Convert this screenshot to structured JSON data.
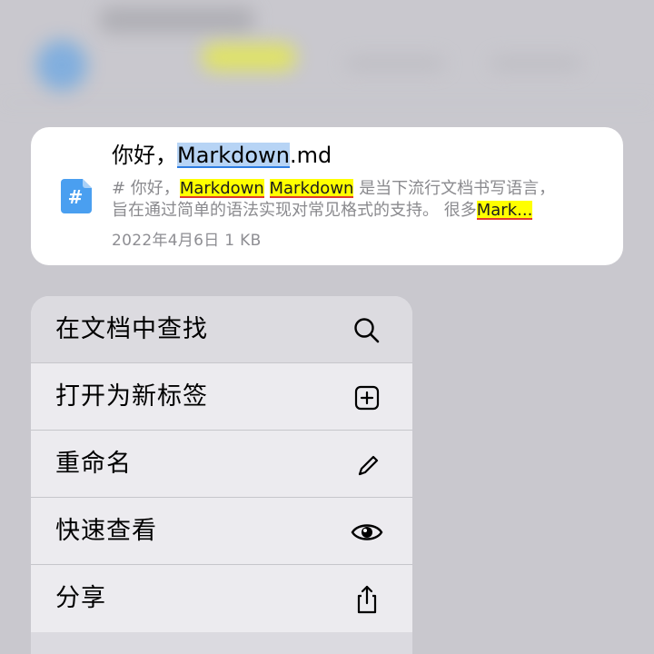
{
  "preview": {
    "title_query": "Markdown",
    "title_rest": ".md",
    "title_prefix": "你好，",
    "file_icon": "markdown-file-icon",
    "snippet_prefix": "# 你好，",
    "snippet_hl1": "Markdown",
    "snippet_hl2": "Markdown",
    "snippet_text1": "是当下流行文档书写语言，",
    "snippet_line2": "旨在通过简单的语法实现对常见格式的支持。 很多",
    "snippet_hl3": "Mark...",
    "meta": "2022年4月6日 1 KB"
  },
  "menu": {
    "items": [
      {
        "label": "在文档中查找",
        "icon": "search-icon"
      },
      {
        "label": "打开为新标签",
        "icon": "plus-square-icon"
      },
      {
        "label": "重命名",
        "icon": "pencil-icon"
      },
      {
        "label": "快速查看",
        "icon": "eye-icon"
      },
      {
        "label": "分享",
        "icon": "share-icon"
      }
    ]
  },
  "colors": {
    "highlight": "#ffff00",
    "selection": "#b7d4f5",
    "accent": "#2f7de1"
  }
}
